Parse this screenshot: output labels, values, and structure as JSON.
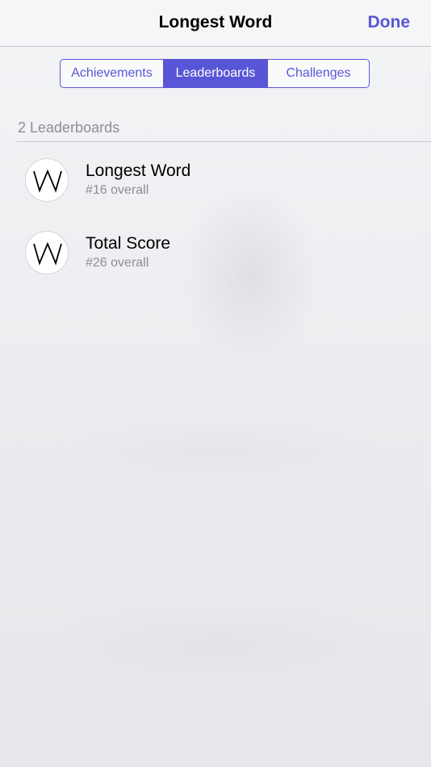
{
  "navbar": {
    "title": "Longest Word",
    "done_label": "Done"
  },
  "tabs": [
    {
      "label": "Achievements",
      "selected": false
    },
    {
      "label": "Leaderboards",
      "selected": true
    },
    {
      "label": "Challenges",
      "selected": false
    }
  ],
  "section": {
    "header": "2 Leaderboards"
  },
  "leaderboards": [
    {
      "title": "Longest Word",
      "rank": "#16 overall",
      "icon": "w-app-icon"
    },
    {
      "title": "Total Score",
      "rank": "#26 overall",
      "icon": "w-app-icon"
    }
  ],
  "colors": {
    "accent": "#5856d6",
    "secondary_text": "#8e8e93",
    "separator": "#c8c9cc"
  }
}
